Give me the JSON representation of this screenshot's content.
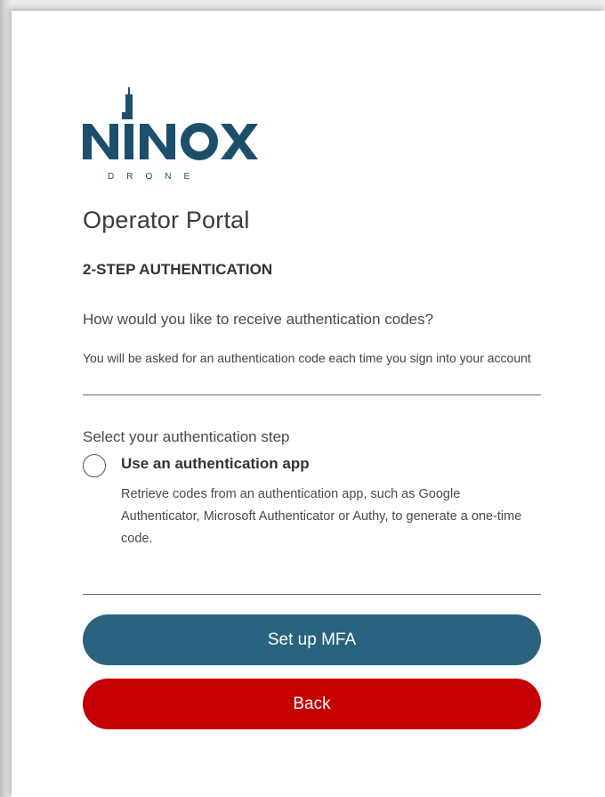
{
  "brand": {
    "logo_name": "NINOX",
    "logo_sub": "DRONE",
    "logo_color": "#1d4f6b"
  },
  "page": {
    "title": "Operator Portal",
    "section_heading": "2-STEP AUTHENTICATION",
    "question": "How would you like to receive authentication codes?",
    "hint": "You will be asked for an authentication code each time you sign into your account",
    "select_label": "Select your authentication step"
  },
  "options": [
    {
      "title": "Use an authentication app",
      "description": "Retrieve codes from an authentication app, such as Google Authenticator, Microsoft Authenticator or Authy, to generate a one-time code.",
      "selected": false
    }
  ],
  "actions": {
    "setup_label": "Set up MFA",
    "back_label": "Back"
  },
  "colors": {
    "primary": "#2a6380",
    "danger": "#c50000"
  }
}
